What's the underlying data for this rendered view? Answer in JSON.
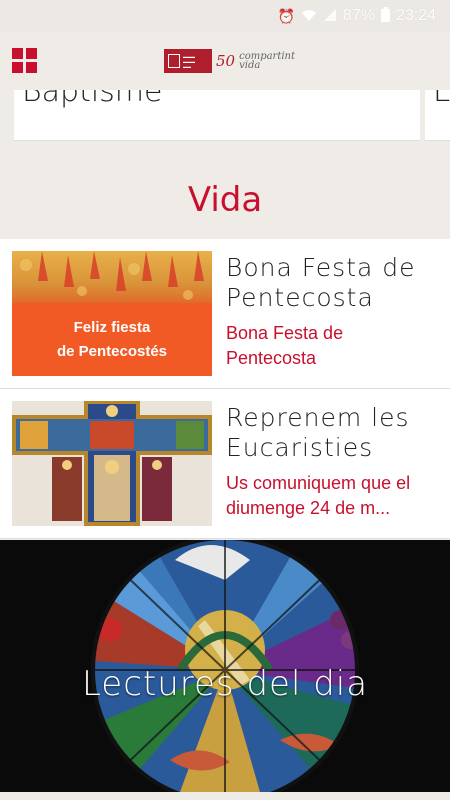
{
  "status_bar": {
    "battery": "87%",
    "time": "23:24"
  },
  "header": {
    "logo_number": "50",
    "logo_years": "anys",
    "logo_tagline_1": "compartint",
    "logo_tagline_2": "vida"
  },
  "top_cards": [
    {
      "title": "Baptisme"
    },
    {
      "title": "E"
    }
  ],
  "section": {
    "title": "Vida"
  },
  "items": [
    {
      "title": "Bona Festa de Pentecosta",
      "subtitle": "Bona Festa de Pentecosta",
      "thumb_text_1": "Feliz fiesta",
      "thumb_text_2": "de Pentecostés"
    },
    {
      "title": "Reprenem les Eucaristies",
      "subtitle": "Us comuniquem que el diumenge 24 de m..."
    }
  ],
  "banner": {
    "title": "Lectures del dia"
  },
  "colors": {
    "accent": "#c8102e",
    "background": "#efebe7"
  }
}
